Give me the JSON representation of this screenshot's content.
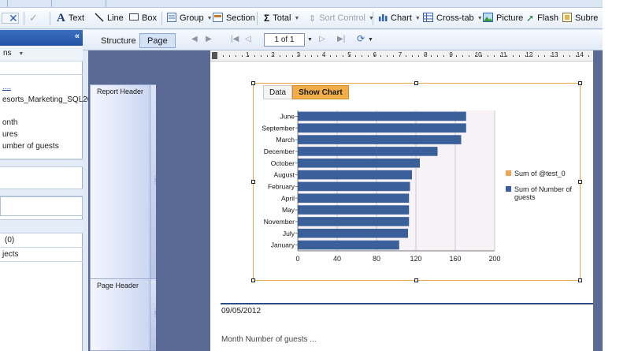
{
  "toolbar": {
    "items": [
      {
        "label": "Text",
        "icon": "text-icon"
      },
      {
        "label": "Line",
        "icon": "line-icon"
      },
      {
        "label": "Box",
        "icon": "box-icon"
      },
      {
        "label": "Group",
        "icon": "group-icon"
      },
      {
        "label": "Section",
        "icon": "section-icon"
      },
      {
        "label": "Total",
        "icon": "sigma-icon"
      },
      {
        "label": "Sort Control",
        "icon": "sort-control-icon"
      },
      {
        "label": "Chart",
        "icon": "chart-icon"
      },
      {
        "label": "Cross-tab",
        "icon": "cross-tab-icon"
      },
      {
        "label": "Picture",
        "icon": "picture-icon"
      },
      {
        "label": "Flash",
        "icon": "flash-icon"
      },
      {
        "label": "Subre",
        "icon": "subreport-icon"
      }
    ]
  },
  "left_panel": {
    "collapse_glyph": "«",
    "combo_text": "ns",
    "tree_lines": [
      "....",
      "esorts_Marketing_SQL20",
      "onth",
      "ures",
      "umber of guests"
    ],
    "count_label": "(0)",
    "objects_label": "jects"
  },
  "designer": {
    "tabs": [
      "Structure",
      "Page"
    ],
    "active_tab": "Page",
    "page_indicator": "1 of 1",
    "ruler_numbers": [
      "1",
      "2",
      "3",
      "4",
      "5",
      "6",
      "7",
      "8",
      "9",
      "10",
      "11",
      "12",
      "13",
      "14"
    ],
    "sections": [
      "Report Header",
      "Page Header"
    ],
    "date_text": "09/05/2012",
    "bottom_text": "Month   Number of guests   ..."
  },
  "chart": {
    "tabs": [
      "Data",
      "Show Chart"
    ],
    "active_tab": "Show Chart",
    "colors": {
      "bar": "#3a5f99",
      "legend_orange": "#f0a45b",
      "plot_bg": "#f6f2f6",
      "frame": "#e6a84a"
    }
  },
  "chart_data": {
    "type": "bar",
    "orientation": "horizontal",
    "categories": [
      "June",
      "September",
      "March",
      "December",
      "October",
      "August",
      "February",
      "April",
      "May",
      "November",
      "July",
      "January"
    ],
    "series": [
      {
        "name": "Sum of @test_0",
        "values": [
          0,
          0,
          0,
          0,
          0,
          0,
          0,
          0,
          0,
          0,
          0,
          0
        ],
        "color": "#f0a45b"
      },
      {
        "name": "Sum of Number of guests",
        "values": [
          171,
          171,
          166,
          142,
          124,
          116,
          114,
          113,
          113,
          113,
          112,
          103
        ],
        "color": "#3a5f99"
      }
    ],
    "xlim": [
      0,
      200
    ],
    "xticks": [
      "0",
      "40",
      "80",
      "120",
      "160",
      "200"
    ],
    "grid": true,
    "legend_position": "right"
  }
}
